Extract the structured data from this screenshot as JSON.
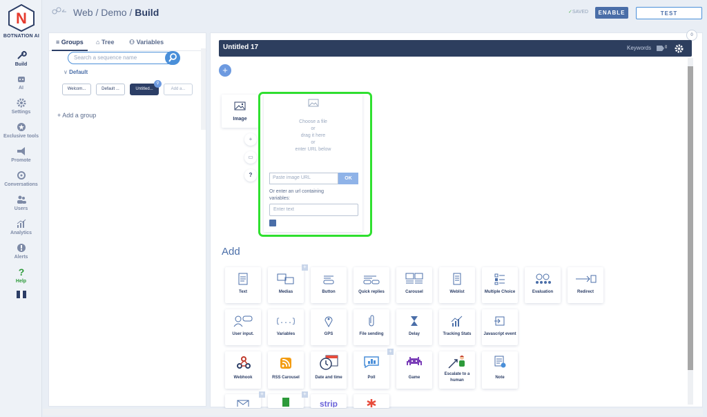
{
  "app": {
    "logo_text": "BOTNATION AI",
    "logo_letter": "N"
  },
  "nav": {
    "items": [
      {
        "label": "Build",
        "icon": "wrench-icon"
      },
      {
        "label": "AI",
        "icon": "robot-icon"
      },
      {
        "label": "Settings",
        "icon": "gear-icon"
      },
      {
        "label": "Exclusive tools",
        "icon": "star-icon"
      },
      {
        "label": "Promote",
        "icon": "megaphone-icon"
      },
      {
        "label": "Conversations",
        "icon": "chat-icon"
      },
      {
        "label": "Users",
        "icon": "users-icon"
      },
      {
        "label": "Analytics",
        "icon": "chart-icon"
      },
      {
        "label": "Alerts",
        "icon": "alert-icon"
      },
      {
        "label": "Help",
        "icon": "help-icon"
      }
    ]
  },
  "header": {
    "breadcrumb": {
      "part1": "Web",
      "sep1": "/",
      "part2": "Demo",
      "sep2": "/",
      "part3": "Build"
    },
    "saved": "SAVED",
    "enable": "ENABLE",
    "test": "TEST"
  },
  "panel": {
    "tabs": [
      "Groups",
      "Tree",
      "Variables"
    ],
    "search_placeholder": "Search a sequence name",
    "group_name": "Default",
    "sequences": [
      "Welcom...",
      "Default ...",
      "Untitled...",
      "Add a..."
    ],
    "add_group": "Add a group"
  },
  "main": {
    "title": "Untitled 17",
    "keywords": "Keywords",
    "keywords_count": "0",
    "counter": "0",
    "image_card_label": "Image",
    "dropzone": [
      "Choose a file",
      "or",
      "drag it here",
      "or",
      "enter URL below"
    ],
    "url_placeholder": "Paste image URL",
    "ok": "OK",
    "var_label": "Or enter an url containing variables:",
    "var_placeholder": "Enter text",
    "add_title": "Add",
    "tiles": [
      "Text",
      "Medias",
      "Button",
      "Quick replies",
      "Carousel",
      "Weblist",
      "Multiple Choice",
      "Evaluation",
      "Redirect",
      "User input.",
      "Variables",
      "GPS",
      "File sending",
      "Delay",
      "Tracking Stats",
      "Javascript event",
      "Webhook",
      "RSS Carousel",
      "Date and time",
      "Poll",
      "Game",
      "Escalate to a human",
      "Note"
    ]
  },
  "colors": {
    "accent": "#4a8fd9",
    "header": "#2d3e5e",
    "highlight": "#2fe02f",
    "brand_red": "#e63b2e"
  }
}
